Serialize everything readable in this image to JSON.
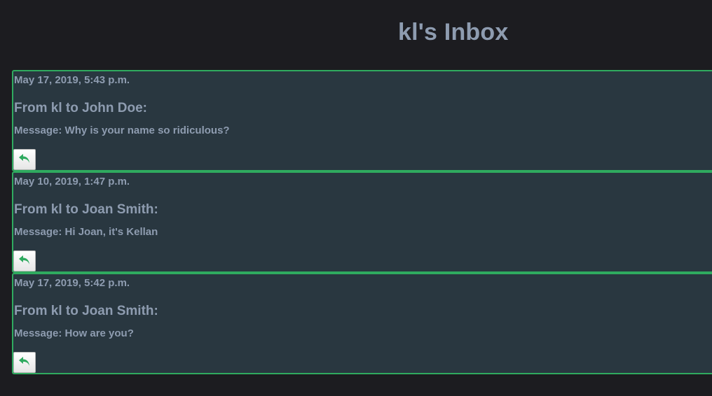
{
  "page": {
    "title": "kl's Inbox"
  },
  "colors": {
    "background": "#1c1c20",
    "card_background": "#293740",
    "card_border": "#2faa5f",
    "text": "#8e9cb0",
    "reply_icon": "#2faa5f"
  },
  "messages": [
    {
      "date": "May 17, 2019, 5:43 p.m.",
      "header": "From kl to John Doe:",
      "body": "Message: Why is your name so ridiculous?",
      "reply_icon": "reply-arrow-icon"
    },
    {
      "date": "May 10, 2019, 1:47 p.m.",
      "header": "From kl to Joan Smith:",
      "body": "Message: Hi Joan, it's Kellan",
      "reply_icon": "reply-arrow-icon"
    },
    {
      "date": "May 17, 2019, 5:42 p.m.",
      "header": "From kl to Joan Smith:",
      "body": "Message: How are you?",
      "reply_icon": "reply-arrow-icon"
    }
  ]
}
